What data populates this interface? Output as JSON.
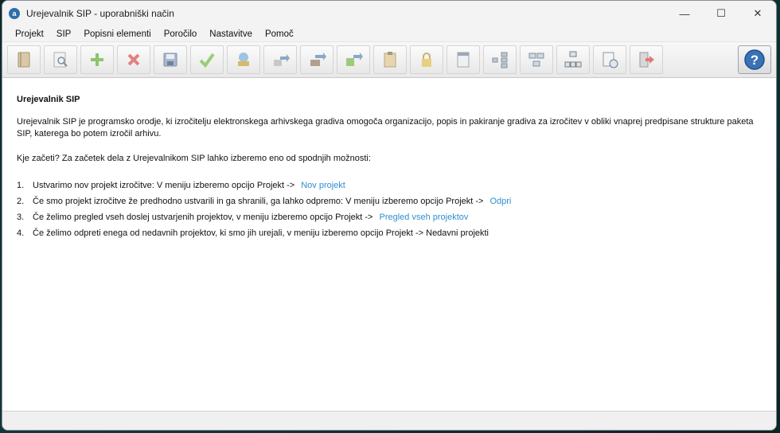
{
  "window": {
    "app_icon_letter": "a",
    "title": "Urejevalnik SIP  - uporabniški način",
    "controls": {
      "minimize": "—",
      "maximize": "☐",
      "close": "✕"
    }
  },
  "menu": [
    "Projekt",
    "SIP",
    "Popisni elementi",
    "Poročilo",
    "Nastavitve",
    "Pomoč"
  ],
  "toolbar": {
    "buttons": [
      "book-icon",
      "search-document-icon",
      "add-icon",
      "delete-icon",
      "save-icon",
      "checkmark-icon",
      "import-icon",
      "export-icon",
      "transfer-icon",
      "move-icon",
      "clipboard-icon",
      "lock-icon",
      "panel-icon",
      "tree-icon",
      "hierarchy-icon",
      "structure-icon",
      "validate-icon",
      "exit-icon"
    ],
    "help_label": "?"
  },
  "content": {
    "heading": "Urejevalnik SIP",
    "intro": "Urejevalnik SIP je programsko orodje, ki izročitelju elektronskega arhivskega gradiva omogoča organizacijo, popis in pakiranje gradiva za izročitev v obliki vnaprej predpisane strukture paketa SIP, katerega bo potem izročil arhivu.",
    "question": "Kje začeti? Za začetek dela z Urejevalnikom SIP lahko izberemo eno od spodnjih možnosti:",
    "steps": [
      {
        "num": "1.",
        "text": "Ustvarimo nov projekt izročitve: V meniju izberemo opcijo Projekt ->",
        "link": "Nov projekt"
      },
      {
        "num": "2.",
        "text": "Če smo projekt izročitve že predhodno ustvarili in ga shranili, ga lahko odpremo: V meniju izberemo opcijo Projekt ->",
        "link": "Odpri"
      },
      {
        "num": "3.",
        "text": "Če želimo pregled vseh doslej ustvarjenih projektov, v meniju izberemo opcijo Projekt ->",
        "link": "Pregled vseh projektov"
      },
      {
        "num": "4.",
        "text": "Če želimo odpreti enega od nedavnih projektov, ki smo jih urejali, v meniju izberemo opcijo Projekt -> Nedavni projekti",
        "link": ""
      }
    ]
  }
}
